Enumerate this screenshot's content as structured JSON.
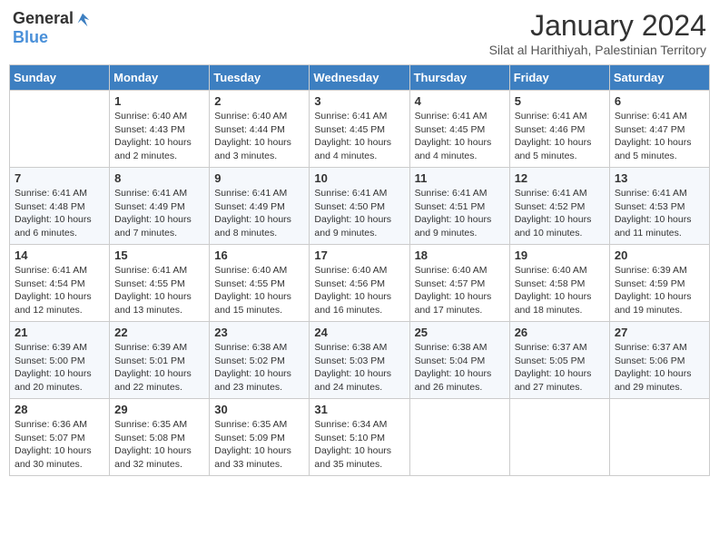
{
  "logo": {
    "general": "General",
    "blue": "Blue"
  },
  "header": {
    "month": "January 2024",
    "location": "Silat al Harithiyah, Palestinian Territory"
  },
  "days_of_week": [
    "Sunday",
    "Monday",
    "Tuesday",
    "Wednesday",
    "Thursday",
    "Friday",
    "Saturday"
  ],
  "weeks": [
    [
      {
        "day": "",
        "sunrise": "",
        "sunset": "",
        "daylight": ""
      },
      {
        "day": "1",
        "sunrise": "Sunrise: 6:40 AM",
        "sunset": "Sunset: 4:43 PM",
        "daylight": "Daylight: 10 hours and 2 minutes."
      },
      {
        "day": "2",
        "sunrise": "Sunrise: 6:40 AM",
        "sunset": "Sunset: 4:44 PM",
        "daylight": "Daylight: 10 hours and 3 minutes."
      },
      {
        "day": "3",
        "sunrise": "Sunrise: 6:41 AM",
        "sunset": "Sunset: 4:45 PM",
        "daylight": "Daylight: 10 hours and 4 minutes."
      },
      {
        "day": "4",
        "sunrise": "Sunrise: 6:41 AM",
        "sunset": "Sunset: 4:45 PM",
        "daylight": "Daylight: 10 hours and 4 minutes."
      },
      {
        "day": "5",
        "sunrise": "Sunrise: 6:41 AM",
        "sunset": "Sunset: 4:46 PM",
        "daylight": "Daylight: 10 hours and 5 minutes."
      },
      {
        "day": "6",
        "sunrise": "Sunrise: 6:41 AM",
        "sunset": "Sunset: 4:47 PM",
        "daylight": "Daylight: 10 hours and 5 minutes."
      }
    ],
    [
      {
        "day": "7",
        "sunrise": "Sunrise: 6:41 AM",
        "sunset": "Sunset: 4:48 PM",
        "daylight": "Daylight: 10 hours and 6 minutes."
      },
      {
        "day": "8",
        "sunrise": "Sunrise: 6:41 AM",
        "sunset": "Sunset: 4:49 PM",
        "daylight": "Daylight: 10 hours and 7 minutes."
      },
      {
        "day": "9",
        "sunrise": "Sunrise: 6:41 AM",
        "sunset": "Sunset: 4:49 PM",
        "daylight": "Daylight: 10 hours and 8 minutes."
      },
      {
        "day": "10",
        "sunrise": "Sunrise: 6:41 AM",
        "sunset": "Sunset: 4:50 PM",
        "daylight": "Daylight: 10 hours and 9 minutes."
      },
      {
        "day": "11",
        "sunrise": "Sunrise: 6:41 AM",
        "sunset": "Sunset: 4:51 PM",
        "daylight": "Daylight: 10 hours and 9 minutes."
      },
      {
        "day": "12",
        "sunrise": "Sunrise: 6:41 AM",
        "sunset": "Sunset: 4:52 PM",
        "daylight": "Daylight: 10 hours and 10 minutes."
      },
      {
        "day": "13",
        "sunrise": "Sunrise: 6:41 AM",
        "sunset": "Sunset: 4:53 PM",
        "daylight": "Daylight: 10 hours and 11 minutes."
      }
    ],
    [
      {
        "day": "14",
        "sunrise": "Sunrise: 6:41 AM",
        "sunset": "Sunset: 4:54 PM",
        "daylight": "Daylight: 10 hours and 12 minutes."
      },
      {
        "day": "15",
        "sunrise": "Sunrise: 6:41 AM",
        "sunset": "Sunset: 4:55 PM",
        "daylight": "Daylight: 10 hours and 13 minutes."
      },
      {
        "day": "16",
        "sunrise": "Sunrise: 6:40 AM",
        "sunset": "Sunset: 4:55 PM",
        "daylight": "Daylight: 10 hours and 15 minutes."
      },
      {
        "day": "17",
        "sunrise": "Sunrise: 6:40 AM",
        "sunset": "Sunset: 4:56 PM",
        "daylight": "Daylight: 10 hours and 16 minutes."
      },
      {
        "day": "18",
        "sunrise": "Sunrise: 6:40 AM",
        "sunset": "Sunset: 4:57 PM",
        "daylight": "Daylight: 10 hours and 17 minutes."
      },
      {
        "day": "19",
        "sunrise": "Sunrise: 6:40 AM",
        "sunset": "Sunset: 4:58 PM",
        "daylight": "Daylight: 10 hours and 18 minutes."
      },
      {
        "day": "20",
        "sunrise": "Sunrise: 6:39 AM",
        "sunset": "Sunset: 4:59 PM",
        "daylight": "Daylight: 10 hours and 19 minutes."
      }
    ],
    [
      {
        "day": "21",
        "sunrise": "Sunrise: 6:39 AM",
        "sunset": "Sunset: 5:00 PM",
        "daylight": "Daylight: 10 hours and 20 minutes."
      },
      {
        "day": "22",
        "sunrise": "Sunrise: 6:39 AM",
        "sunset": "Sunset: 5:01 PM",
        "daylight": "Daylight: 10 hours and 22 minutes."
      },
      {
        "day": "23",
        "sunrise": "Sunrise: 6:38 AM",
        "sunset": "Sunset: 5:02 PM",
        "daylight": "Daylight: 10 hours and 23 minutes."
      },
      {
        "day": "24",
        "sunrise": "Sunrise: 6:38 AM",
        "sunset": "Sunset: 5:03 PM",
        "daylight": "Daylight: 10 hours and 24 minutes."
      },
      {
        "day": "25",
        "sunrise": "Sunrise: 6:38 AM",
        "sunset": "Sunset: 5:04 PM",
        "daylight": "Daylight: 10 hours and 26 minutes."
      },
      {
        "day": "26",
        "sunrise": "Sunrise: 6:37 AM",
        "sunset": "Sunset: 5:05 PM",
        "daylight": "Daylight: 10 hours and 27 minutes."
      },
      {
        "day": "27",
        "sunrise": "Sunrise: 6:37 AM",
        "sunset": "Sunset: 5:06 PM",
        "daylight": "Daylight: 10 hours and 29 minutes."
      }
    ],
    [
      {
        "day": "28",
        "sunrise": "Sunrise: 6:36 AM",
        "sunset": "Sunset: 5:07 PM",
        "daylight": "Daylight: 10 hours and 30 minutes."
      },
      {
        "day": "29",
        "sunrise": "Sunrise: 6:35 AM",
        "sunset": "Sunset: 5:08 PM",
        "daylight": "Daylight: 10 hours and 32 minutes."
      },
      {
        "day": "30",
        "sunrise": "Sunrise: 6:35 AM",
        "sunset": "Sunset: 5:09 PM",
        "daylight": "Daylight: 10 hours and 33 minutes."
      },
      {
        "day": "31",
        "sunrise": "Sunrise: 6:34 AM",
        "sunset": "Sunset: 5:10 PM",
        "daylight": "Daylight: 10 hours and 35 minutes."
      },
      {
        "day": "",
        "sunrise": "",
        "sunset": "",
        "daylight": ""
      },
      {
        "day": "",
        "sunrise": "",
        "sunset": "",
        "daylight": ""
      },
      {
        "day": "",
        "sunrise": "",
        "sunset": "",
        "daylight": ""
      }
    ]
  ]
}
